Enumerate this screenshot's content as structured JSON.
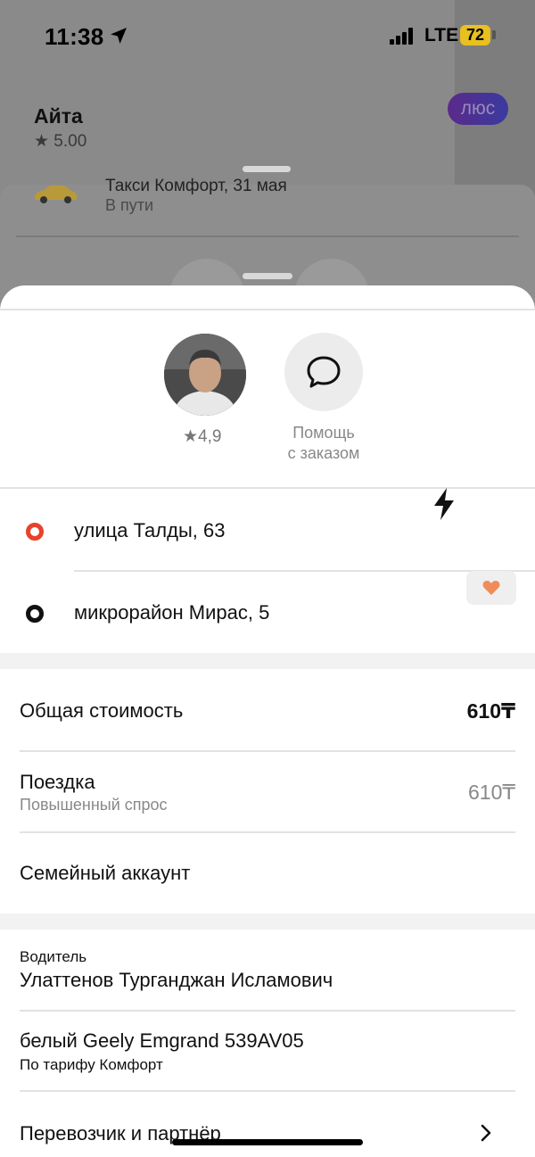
{
  "status_bar": {
    "time": "11:38",
    "network": "LTE",
    "battery": "72"
  },
  "background": {
    "profile_name": "Айта",
    "profile_rating": "★ 5.00",
    "plus_label": "люс",
    "order_title": "Такси Комфорт, 31 мая",
    "order_status": "В пути"
  },
  "driver_card": {
    "rating": "★4,9",
    "help_label_line1": "Помощь",
    "help_label_line2": "с заказом"
  },
  "route": {
    "from": "улица Талды, 63",
    "to": "микрорайон Мирас, 5"
  },
  "cost": {
    "total_label": "Общая стоимость",
    "total_value": "610₸",
    "trip_label": "Поездка",
    "trip_sub": "Повышенный спрос",
    "trip_value": "610₸",
    "family_label": "Семейный аккаунт"
  },
  "driver_info": {
    "driver_caption": "Водитель",
    "driver_name": "Улаттенов Турганджан Исламович",
    "car": "белый Geely Emgrand 539AV05",
    "tariff": "По тарифу Комфорт",
    "carrier_label": "Перевозчик и партнёр"
  },
  "colors": {
    "from_dot": "#e8412c",
    "to_dot": "#111111",
    "heart": "#f08c5a"
  }
}
